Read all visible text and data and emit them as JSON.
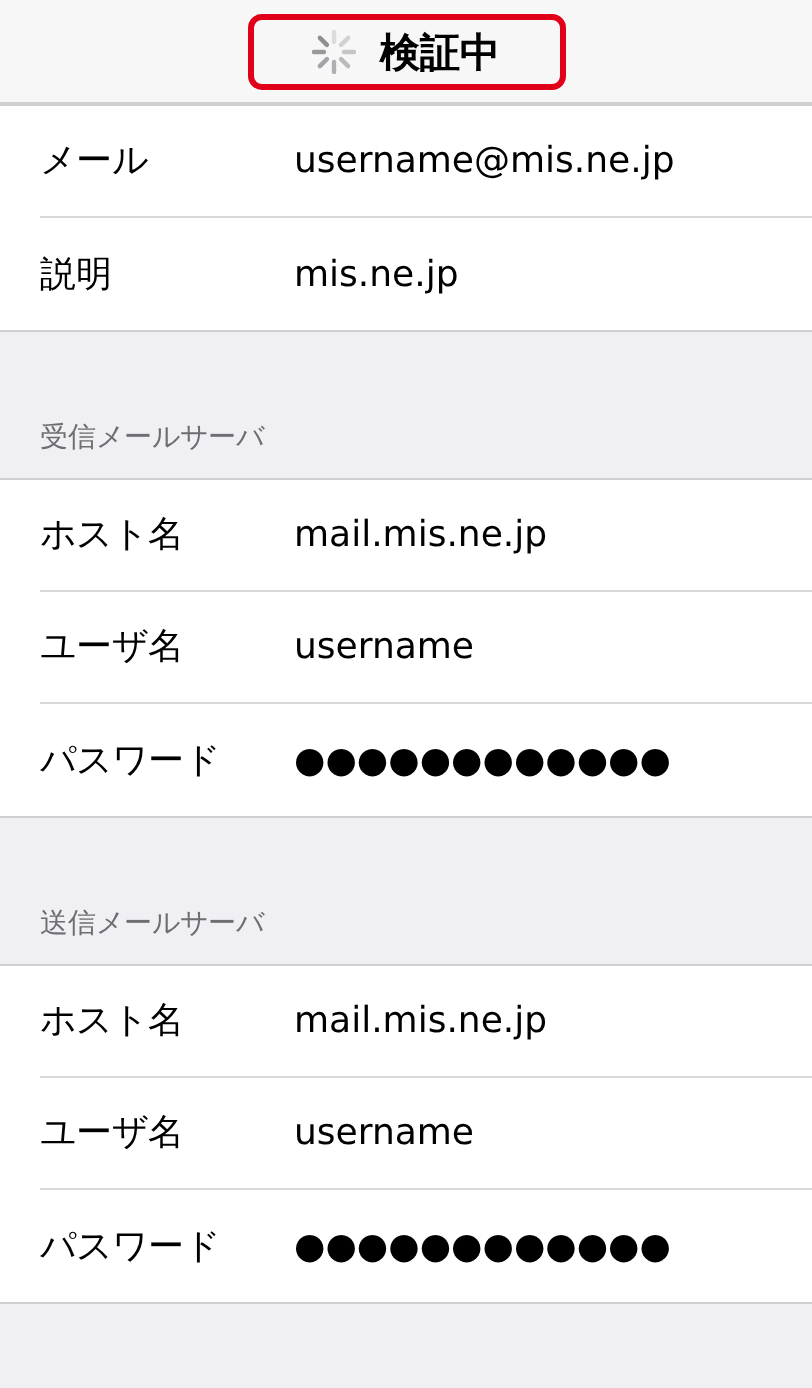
{
  "nav_bar": {
    "title": "検証中",
    "loading": true,
    "highlighted": true
  },
  "sections": [
    {
      "rows": [
        {
          "label": "メール",
          "value": "username@mis.ne.jp"
        },
        {
          "label": "説明",
          "value": "mis.ne.jp"
        }
      ]
    },
    {
      "header": "受信メールサーバ",
      "rows": [
        {
          "label": "ホスト名",
          "value": "mail.mis.ne.jp"
        },
        {
          "label": "ユーザ名",
          "value": "username"
        },
        {
          "label": "パスワード",
          "value": "●●●●●●●●●●●●"
        }
      ]
    },
    {
      "header": "送信メールサーバ",
      "rows": [
        {
          "label": "ホスト名",
          "value": "mail.mis.ne.jp"
        },
        {
          "label": "ユーザ名",
          "value": "username"
        },
        {
          "label": "パスワード",
          "value": "●●●●●●●●●●●●"
        }
      ]
    }
  ]
}
